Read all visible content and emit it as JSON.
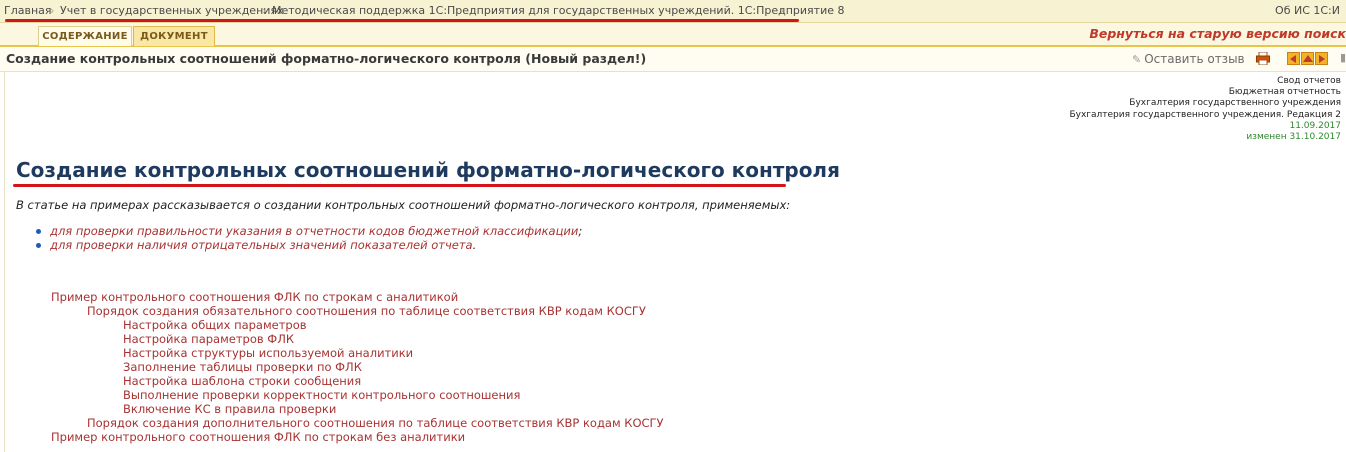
{
  "breadcrumbs": [
    "Главная",
    "Учет в государственных учреждениях",
    "Методическая поддержка 1С:Предприятия для государственных учреждений. 1С:Предприятие 8"
  ],
  "breadcrumb_right": "Об ИС 1С:И",
  "tabs": [
    "СОДЕРЖАНИЕ",
    "ДОКУМЕНТ"
  ],
  "back_link": "Вернуться на старую версию поиск",
  "toolbar": {
    "title": "Создание контрольных соотношений форматно-логического контроля (Новый раздел!)",
    "feedback": "Оставить отзыв"
  },
  "meta": {
    "lines": [
      "Свод отчетов",
      "Бюджетная отчетность",
      "Бухгалтерия государственного учреждения",
      "Бухгалтерия государственного учреждения. Редакция 2"
    ],
    "date": "11.09.2017",
    "changed": "изменен 31.10.2017"
  },
  "article": {
    "heading": "Создание контрольных соотношений форматно-логического контроля",
    "intro": "В статье на примерах рассказывается о создании контрольных соотношений форматно-логического контроля, применяемых:",
    "bullets": [
      {
        "link": "для проверки правильности указания в отчетности кодов бюджетной классификации",
        "tail": ";"
      },
      {
        "link": "для проверки наличия отрицательных значений показателей отчета",
        "tail": "."
      }
    ],
    "toc": [
      "Пример контрольного соотношения ФЛК по строкам с аналитикой",
      "Порядок создания обязательного соотношения по таблице соответствия КВР кодам КОСГУ",
      "Настройка общих параметров",
      "Настройка параметров ФЛК",
      "Настройка структуры используемой аналитики",
      "Заполнение таблицы проверки по ФЛК",
      "Настройка шаблона строки сообщения",
      "Выполнение проверки корректности контрольного соотношения",
      "Включение КС в правила проверки",
      "Порядок создания дополнительного соотношения по таблице соответствия КВР кодам КОСГУ",
      "Пример контрольного соотношения ФЛК по строкам без аналитики"
    ]
  },
  "colors": {
    "accent_red": "#d4141b",
    "heading_blue": "#1f3a5f",
    "link_red": "#a83232"
  }
}
